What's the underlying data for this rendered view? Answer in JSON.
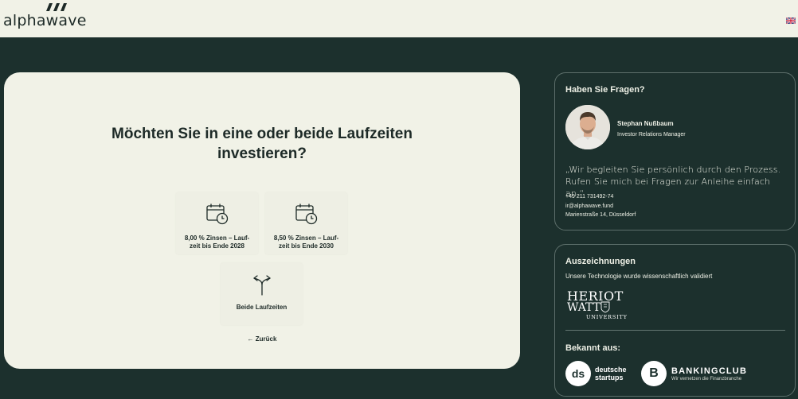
{
  "header": {
    "logo_text": "alphawave",
    "language_icon": "uk-flag-icon"
  },
  "main": {
    "title_line1": "Möchten Sie in eine oder beide Laufzeiten",
    "title_line2": "investieren?",
    "options": [
      {
        "icon": "calendar-clock-icon",
        "label_line1": "8,00 % Zinsen – Lauf-",
        "label_line2": "zeit bis Ende 2028"
      },
      {
        "icon": "calendar-clock-icon",
        "label_line1": "8,50 % Zinsen – Lauf-",
        "label_line2": "zeit bis Ende 2030"
      },
      {
        "icon": "split-arrows-icon",
        "label_line1": "Beide Laufzeiten"
      }
    ],
    "back_label": "← Zurück"
  },
  "questions": {
    "heading": "Haben Sie Fragen?",
    "person_name": "Stephan Nußbaum",
    "person_role": "Investor Relations Manager",
    "quote_line1": "„Wir begleiten Sie persönlich durch den Prozess.",
    "quote_line2": "Rufen Sie mich bei Fragen zur Anleihe einfach an.“",
    "phone": "+49 211 731492-74",
    "email": "ir@alphawave.fund",
    "address": "Marienstraße 14, Düsseldorf"
  },
  "awards": {
    "heading": "Auszeichnungen",
    "subtitle": "Unsere Technologie wurde wissenschaftlich validiert",
    "hw_line1": "HERIOT",
    "hw_line2": "WATT",
    "hw_line3": "UNIVERSITY",
    "known_heading": "Bekannt aus:",
    "ds_mark": "ds",
    "ds_line1": "deutsche",
    "ds_line2": "startups",
    "bc_mark": "B",
    "bc_title": "BANKINGCLUB",
    "bc_subtitle": "Wir vernetzen die Finanzbranche"
  },
  "colors": {
    "background": "#1c302d",
    "card": "#f1f2e7",
    "text_dark": "#1d2a27"
  }
}
